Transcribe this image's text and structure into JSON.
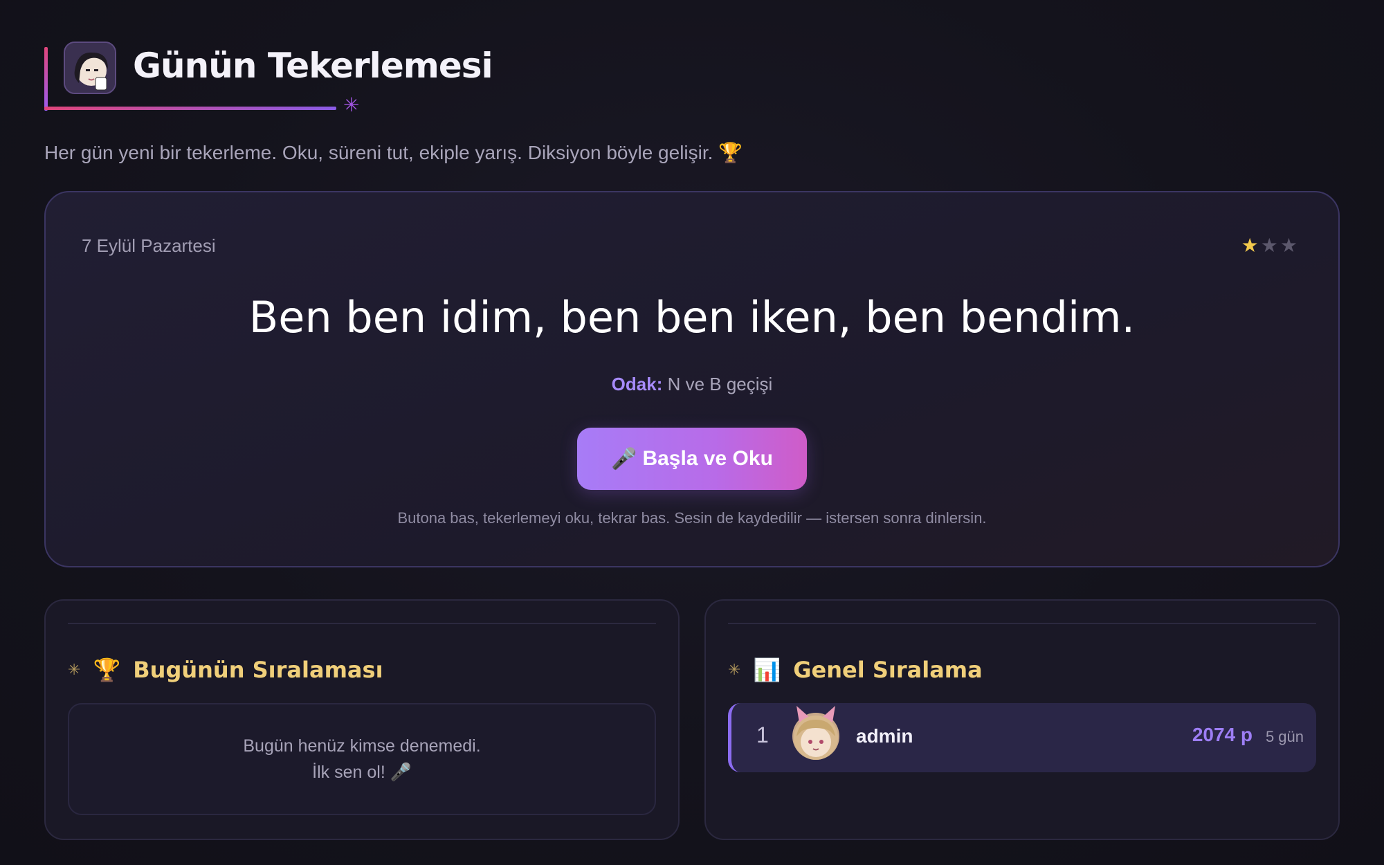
{
  "header": {
    "title": "Günün Tekerlemesi",
    "logo_icon": "anime-avatar-icon",
    "sparkle_icon": "sparkle-icon",
    "accent_colors": [
      "#e0457b",
      "#9b5cf0"
    ]
  },
  "subtitle": "Her gün yeni bir tekerleme. Oku, süreni tut, ekiple yarış. Diksiyon böyle gelişir. 🏆",
  "daily": {
    "date": "7 Eylül Pazartesi",
    "difficulty": {
      "filled": 1,
      "total": 3
    },
    "phrase": "Ben ben idim, ben ben iken, ben bendim.",
    "focus_label": "Odak:",
    "focus_value": "N ve B geçişi",
    "start_button_icon": "🎤",
    "start_button_label": "Başla ve Oku",
    "hint": "Butona bas, tekerlemeyi oku, tekrar bas. Sesin de kaydedilir — istersen sonra dinlersin."
  },
  "today_ranking": {
    "icon": "🏆",
    "title": "Bugünün Sıralaması",
    "empty_line1": "Bugün henüz kimse denemedi.",
    "empty_line2": "İlk sen ol! 🎤"
  },
  "overall_ranking": {
    "icon": "📊",
    "title": "Genel Sıralama",
    "rows": [
      {
        "rank": "1",
        "name": "admin",
        "points": "2074 p",
        "days": "5 gün"
      }
    ]
  },
  "colors": {
    "background": "#13121b",
    "accent_purple": "#a78bfa",
    "gold_title": "#f0cf7a",
    "star_gold": "#f2c94c"
  }
}
